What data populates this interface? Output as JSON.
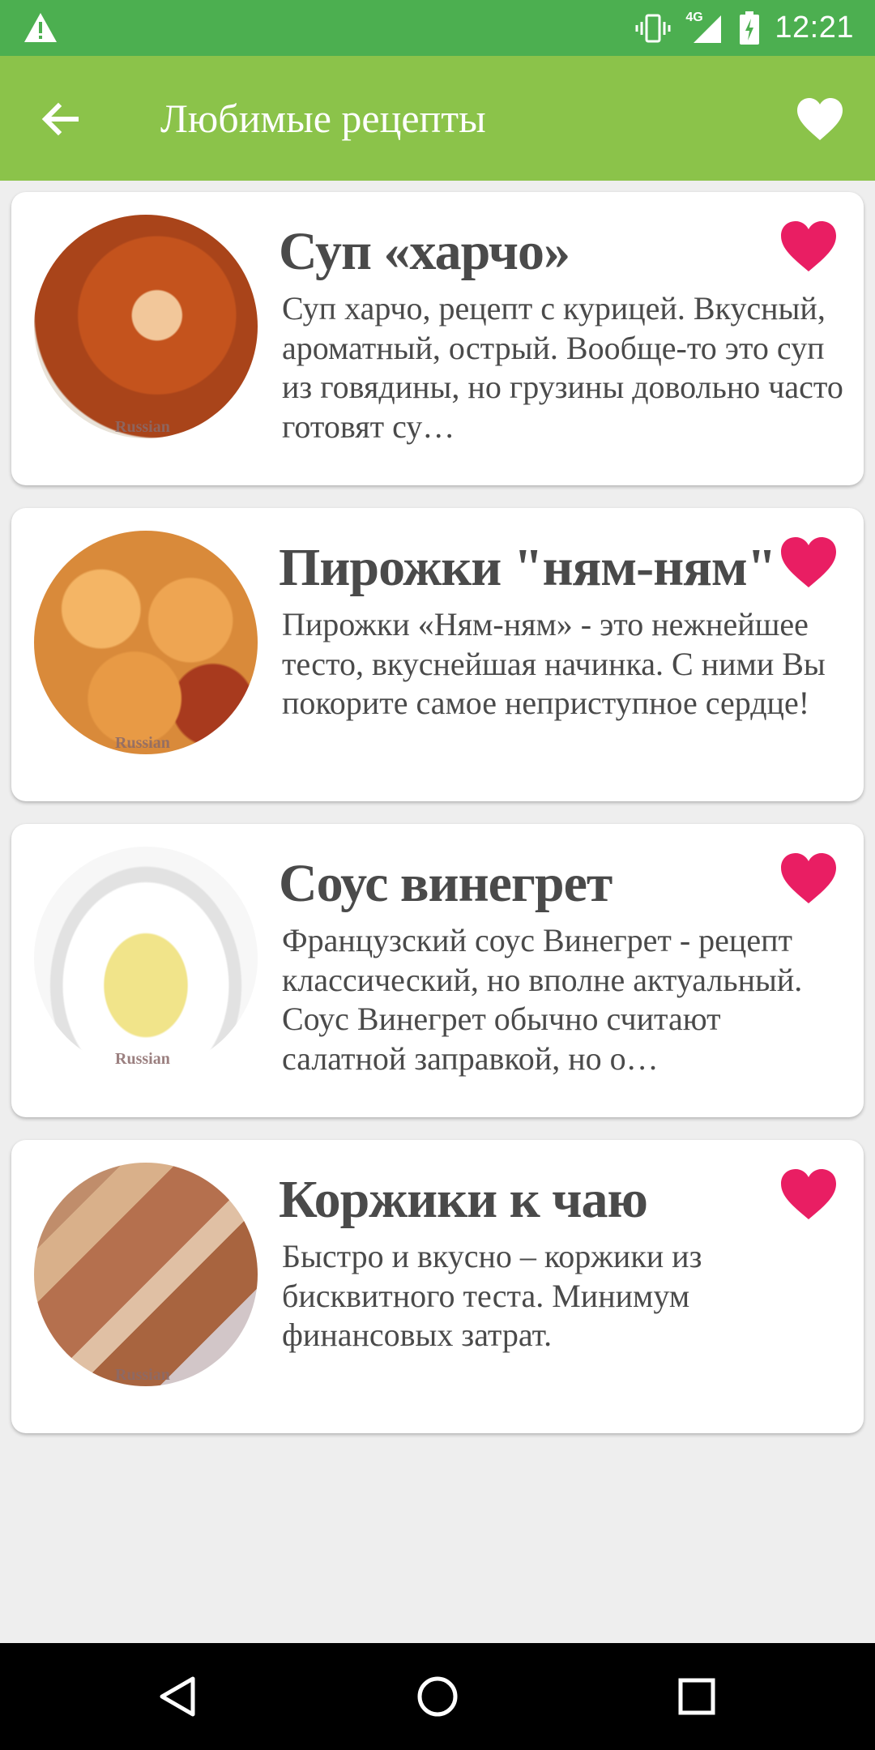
{
  "status_bar": {
    "network": "4G",
    "time": "12:21",
    "icons": [
      "warning-icon",
      "vibrate-icon",
      "signal-icon",
      "battery-icon"
    ]
  },
  "toolbar": {
    "title": "Любимые рецепты",
    "back_icon": "arrow-left-icon",
    "favorite_icon": "heart-icon"
  },
  "colors": {
    "status_bar": "#4CAF50",
    "toolbar": "#8BC34A",
    "heart": "#E91E63",
    "background": "#EEEEEE"
  },
  "recipes": [
    {
      "name": "Суп «харчо»",
      "description": "Суп харчо, рецепт с курицей. Вкусный, ароматный, острый. Вообще-то это суп из говядины, но грузины довольно часто готовят су…",
      "favorite": true
    },
    {
      "name": "Пирожки \"ням-ням\"",
      "description": "Пирожки «Ням-ням» - это нежнейшее тесто, вкуснейшая начинка. С ними Вы покорите самое неприступное сердце!",
      "favorite": true
    },
    {
      "name": "Соус винегрет",
      "description": "Французский соус Винегрет - рецепт классический, но вполне актуальный. Соус Винегрет обычно считают салатной заправкой, но о…",
      "favorite": true
    },
    {
      "name": "Коржики к чаю",
      "description": "Быстро и вкусно – коржики из бисквитного теста. Минимум финансовых затрат.",
      "favorite": true
    }
  ],
  "nav_bar": {
    "icons": [
      "back-triangle-icon",
      "home-circle-icon",
      "recents-square-icon"
    ]
  }
}
